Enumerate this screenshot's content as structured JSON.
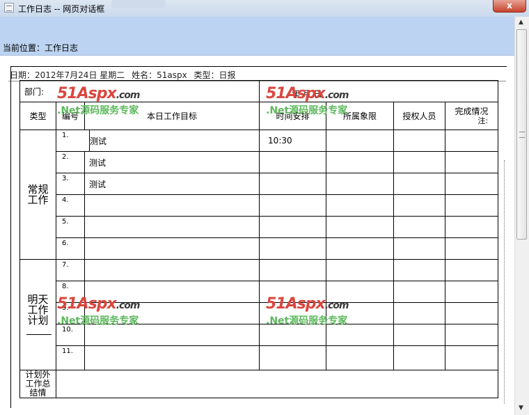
{
  "window": {
    "title": "工作日志 -- 网页对话框",
    "close_glyph": "x"
  },
  "page": {
    "breadcrumb": "当前位置：工作日志"
  },
  "info": {
    "date": "日期：2012年7月24日 星期二",
    "name": "姓名：51aspx",
    "type": "类型：日报"
  },
  "table": {
    "dept_label": "部门:",
    "date_label": "年 月 日",
    "headers": [
      "类型",
      "编号",
      "本日工作目标",
      "时间安排",
      "所属象限",
      "授权人员",
      "完成情况"
    ],
    "header_note": "注:",
    "categories": {
      "regular": "常规工作",
      "tomorrow": "明天工作计划",
      "unplanned": "计划外工作总结情"
    },
    "rows": [
      {
        "no": "1.",
        "task": "测试",
        "time": "10:30"
      },
      {
        "no": "2.",
        "task": "测试",
        "time": ""
      },
      {
        "no": "3.",
        "task": "测试",
        "time": ""
      },
      {
        "no": "4.",
        "task": "",
        "time": ""
      },
      {
        "no": "5.",
        "task": "",
        "time": ""
      },
      {
        "no": "6.",
        "task": "",
        "time": ""
      },
      {
        "no": "7.",
        "task": "",
        "time": ""
      },
      {
        "no": "8.",
        "task": "",
        "time": ""
      },
      {
        "no": "9.",
        "task": "",
        "time": ""
      },
      {
        "no": "10.",
        "task": "",
        "time": ""
      },
      {
        "no": "11.",
        "task": "",
        "time": ""
      }
    ]
  },
  "watermark": {
    "logo": "51Aspx",
    "domain": ".com",
    "slogan": ".Net源码服务专家"
  },
  "colors": {
    "header_band": "#bcd3f1",
    "watermark_red": "#d9473f",
    "watermark_green": "#5cb85c"
  }
}
